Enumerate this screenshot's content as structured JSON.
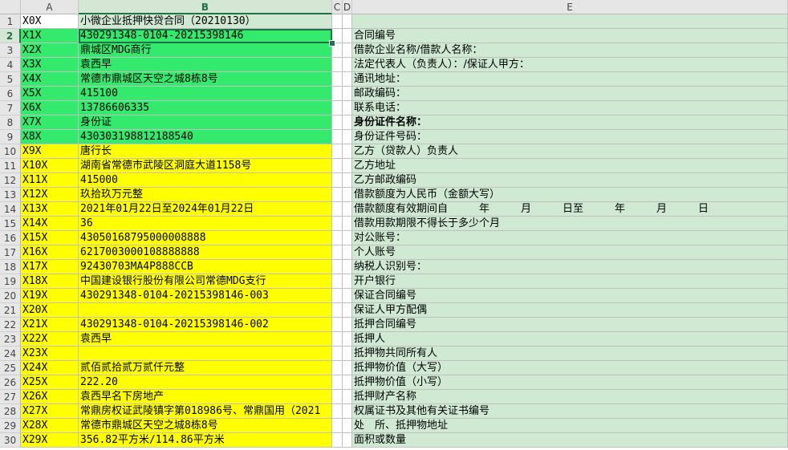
{
  "columns": [
    "A",
    "B",
    "C",
    "D",
    "E"
  ],
  "active_column": "B",
  "active_row": 2,
  "rows": [
    {
      "n": "1",
      "a": "X0X",
      "b": "小微企业抵押快贷合同（20210130）",
      "e": "",
      "fill": "lg"
    },
    {
      "n": "2",
      "a": "X1X",
      "b": "430291348-0104-20215398146",
      "e": "合同编号",
      "fill": "g"
    },
    {
      "n": "3",
      "a": "X2X",
      "b": "鼎城区MDG商行",
      "e": "借款企业名称/借款人名称：",
      "fill": "g"
    },
    {
      "n": "4",
      "a": "X3X",
      "b": "袁西早",
      "e": "法定代表人（负责人）：/保证人甲方：",
      "fill": "g"
    },
    {
      "n": "5",
      "a": "X4X",
      "b": "常德市鼎城区天空之城8栋8号",
      "e": "通讯地址：",
      "fill": "g"
    },
    {
      "n": "6",
      "a": "X5X",
      "b": "415100",
      "e": "邮政编码：",
      "fill": "g"
    },
    {
      "n": "7",
      "a": "X6X",
      "b": "13786606335",
      "e": "联系电话：",
      "fill": "g"
    },
    {
      "n": "8",
      "a": "X7X",
      "b": "身份证",
      "e": "身份证件名称：",
      "fill": "g",
      "bold_e": true
    },
    {
      "n": "9",
      "a": "X8X",
      "b": "430303198812188540",
      "e": "身份证件号码：",
      "fill": "g"
    },
    {
      "n": "10",
      "a": "X9X",
      "b": "唐行长",
      "e": "乙方（贷款人）负责人",
      "fill": "y"
    },
    {
      "n": "11",
      "a": "X10X",
      "b": "湖南省常德市武陵区洞庭大道1158号",
      "e": "乙方地址",
      "fill": "y"
    },
    {
      "n": "12",
      "a": "X11X",
      "b": "415000",
      "e": "乙方邮政编码",
      "fill": "y"
    },
    {
      "n": "13",
      "a": "X12X",
      "b": "玖拾玖万元整",
      "e": "借款额度为人民币（金额大写）",
      "fill": "y"
    },
    {
      "n": "14",
      "a": "X13X",
      "b": "2021年01月22日至2024年01月22日",
      "e": "借款额度有效期间自　　　年　　　月　　　日至　　　年　　　月　　　日",
      "fill": "y"
    },
    {
      "n": "15",
      "a": "X14X",
      "b": "36",
      "e": "借款用款期限不得长于多少个月",
      "fill": "y"
    },
    {
      "n": "16",
      "a": "X15X",
      "b": "43050168795000008888",
      "e": "对公账号：",
      "fill": "y"
    },
    {
      "n": "17",
      "a": "X16X",
      "b": "6217003000108888888",
      "e": "个人账号",
      "fill": "y"
    },
    {
      "n": "18",
      "a": "X17X",
      "b": "92430703MA4P888CCB",
      "e": "纳税人识别号：",
      "fill": "y"
    },
    {
      "n": "19",
      "a": "X18X",
      "b": "中国建设银行股份有限公司常德MDG支行",
      "e": "开户银行",
      "fill": "y"
    },
    {
      "n": "20",
      "a": "X19X",
      "b": "430291348-0104-20215398146-003",
      "e": "保证合同编号",
      "fill": "y"
    },
    {
      "n": "21",
      "a": "X20X",
      "b": "",
      "e": "保证人甲方配偶",
      "fill": "y"
    },
    {
      "n": "22",
      "a": "X21X",
      "b": "430291348-0104-20215398146-002",
      "e": "抵押合同编号",
      "fill": "y"
    },
    {
      "n": "23",
      "a": "X22X",
      "b": "袁西早",
      "e": "抵押人",
      "fill": "y"
    },
    {
      "n": "24",
      "a": "X23X",
      "b": "",
      "e": "抵押物共同所有人",
      "fill": "y"
    },
    {
      "n": "25",
      "a": "X24X",
      "b": "贰佰贰拾贰万贰仟元整",
      "e": "抵押物价值（大写）",
      "fill": "y"
    },
    {
      "n": "26",
      "a": "X25X",
      "b": "222.20",
      "e": "抵押物价值（小写）",
      "fill": "y"
    },
    {
      "n": "27",
      "a": "X26X",
      "b": "袁西早名下房地产",
      "e": "抵押财产名称",
      "fill": "y"
    },
    {
      "n": "28",
      "a": "X27X",
      "b": "常鼎房权证武陵镇字第018986号、常鼎国用（2021",
      "e": "权属证书及其他有关证书编号",
      "fill": "y"
    },
    {
      "n": "29",
      "a": "X28X",
      "b": "常德市鼎城区天空之城8栋8号",
      "e": "处　所、抵押物地址",
      "fill": "y"
    },
    {
      "n": "30",
      "a": "X29X",
      "b": "356.82平方米/114.86平方米",
      "e": "面积或数量",
      "fill": "y"
    }
  ],
  "colors": {
    "yellow": "#ffff00",
    "green": "#33ea6d",
    "light_green": "#cfe9d3",
    "accent": "#217346"
  }
}
